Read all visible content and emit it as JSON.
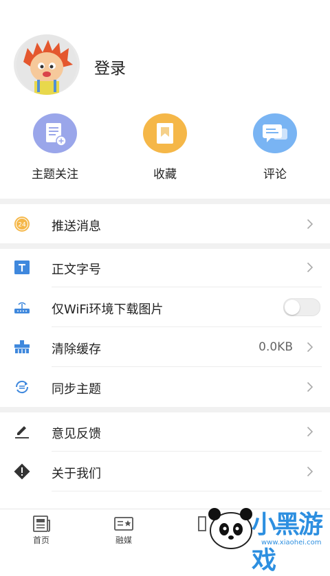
{
  "profile": {
    "login_label": "登录"
  },
  "quick_actions": [
    {
      "label": "主题关注",
      "icon": "subscribe-doc-icon",
      "color": "#9aa6ea"
    },
    {
      "label": "收藏",
      "icon": "bookmark-icon",
      "color": "#f5b748"
    },
    {
      "label": "评论",
      "icon": "comment-icon",
      "color": "#79b4f3"
    }
  ],
  "settings": {
    "push": {
      "label": "推送消息",
      "badge": "24"
    },
    "font_size": {
      "label": "正文字号"
    },
    "wifi_only": {
      "label": "仅WiFi环境下载图片",
      "enabled": false
    },
    "clear_cache": {
      "label": "清除缓存",
      "value": "0.0KB"
    },
    "sync_theme": {
      "label": "同步主题"
    },
    "feedback": {
      "label": "意见反馈"
    },
    "about": {
      "label": "关于我们"
    }
  },
  "tabbar": [
    {
      "label": "首页",
      "icon": "newspaper-icon"
    },
    {
      "label": "融媒",
      "icon": "media-card-icon"
    },
    {
      "label": "",
      "icon": "hidden-tab-icon"
    }
  ],
  "watermark": {
    "text": "小黑游戏",
    "url": "www.xiaohei.com"
  }
}
